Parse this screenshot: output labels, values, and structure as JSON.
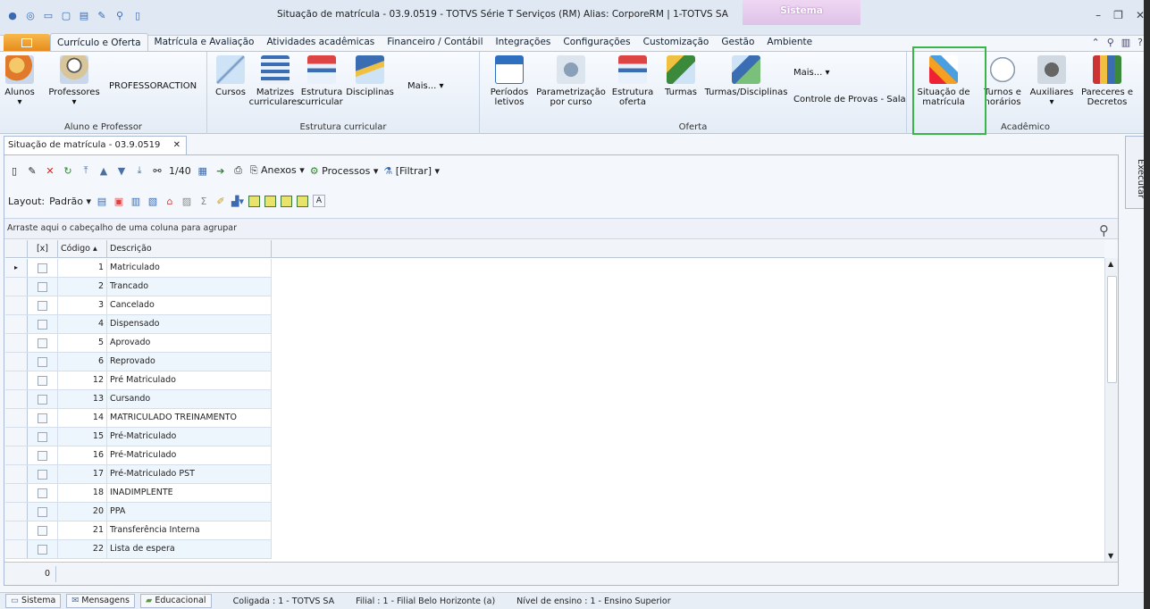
{
  "window": {
    "title": "Situação de matrícula - 03.9.0519 - TOTVS Série T Serviços (RM) Alias: CorporeRM | 1-TOTVS SA",
    "system_tab": "Sistema"
  },
  "menu_tabs": [
    "Currículo e Oferta",
    "Matrícula e Avaliação",
    "Atividades acadêmicas",
    "Financeiro / Contábil",
    "Integrações",
    "Configurações",
    "Customização",
    "Gestão",
    "Ambiente"
  ],
  "ribbon": {
    "g1": {
      "label": "Aluno e Professor",
      "alunos": "Alunos",
      "professores": "Professores",
      "professoraction": "PROFESSORACTION"
    },
    "g2": {
      "label": "Estrutura curricular",
      "cursos": "Cursos",
      "matrizes": "Matrizes curriculares",
      "estrutura": "Estrutura curricular",
      "disciplinas": "Disciplinas",
      "mais": "Mais..."
    },
    "g3": {
      "label": "Oferta",
      "periodos": "Períodos letivos",
      "parametrizacao": "Parametrização por curso",
      "estrutura_oferta": "Estrutura oferta",
      "turmas": "Turmas",
      "turmas_disc": "Turmas/Disciplinas",
      "mais": "Mais...",
      "controle": "Controle de Provas - Sala"
    },
    "g4": {
      "label": "Acadêmico",
      "situacao": "Situação de matrícula",
      "turnos": "Turnos e horários",
      "auxiliares": "Auxiliares",
      "pareceres": "Pareceres e Decretos"
    }
  },
  "doc_tab": "Situação de matrícula - 03.9.0519",
  "toolbar": {
    "counter": "1/40",
    "anexos": "Anexos",
    "processos": "Processos",
    "filtrar": "[Filtrar]",
    "layout": "Layout:",
    "padrao": "Padrão"
  },
  "grid": {
    "group_hint": "Arraste aqui o cabeçalho de uma coluna para agrupar",
    "headers": [
      "[x]",
      "Código",
      "Descrição"
    ],
    "rows": [
      [
        "1",
        "Matriculado"
      ],
      [
        "2",
        "Trancado"
      ],
      [
        "3",
        "Cancelado"
      ],
      [
        "4",
        "Dispensado"
      ],
      [
        "5",
        "Aprovado"
      ],
      [
        "6",
        "Reprovado"
      ],
      [
        "12",
        "Pré Matriculado"
      ],
      [
        "13",
        "Cursando"
      ],
      [
        "14",
        "MATRICULADO TREINAMENTO"
      ],
      [
        "15",
        "Pré-Matriculado"
      ],
      [
        "16",
        "Pré-Matriculado"
      ],
      [
        "17",
        "Pré-Matriculado PST"
      ],
      [
        "18",
        "INADIMPLENTE"
      ],
      [
        "20",
        "PPA"
      ],
      [
        "21",
        "Transferência Interna"
      ],
      [
        "22",
        "Lista de espera"
      ]
    ],
    "footer_count": "0"
  },
  "side_panel": "Executar",
  "status": {
    "sistema": "Sistema",
    "mensagens": "Mensagens",
    "educacional": "Educacional",
    "coligada": "Coligada : 1 - TOTVS SA",
    "filial": "Filial : 1 - Filial Belo Horizonte (a)",
    "nivel": "Nível de ensino : 1 - Ensino Superior"
  }
}
